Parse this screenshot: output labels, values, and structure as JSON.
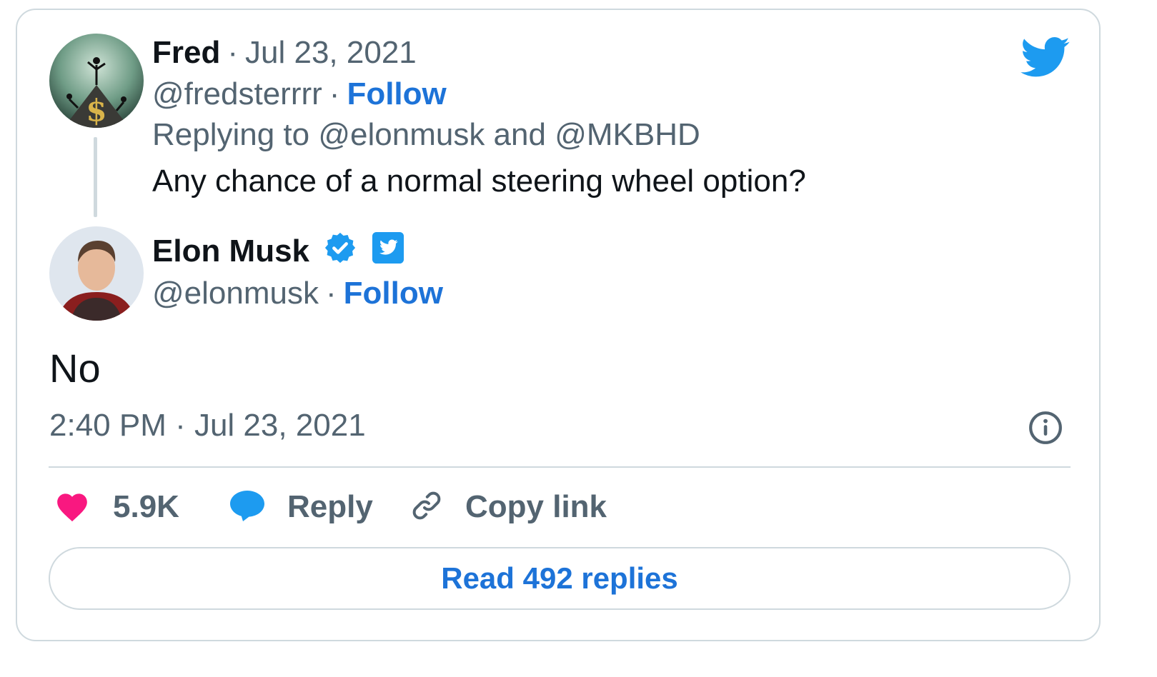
{
  "reply_tweet": {
    "author_name": "Fred",
    "date": "Jul 23, 2021",
    "handle": "@fredsterrrr",
    "follow_label": "Follow",
    "replying_to": "Replying to @elonmusk and @MKBHD",
    "text": "Any chance of a normal steering wheel option?"
  },
  "main_tweet": {
    "author_name": "Elon Musk",
    "handle": "@elonmusk",
    "follow_label": "Follow",
    "text": "No",
    "timestamp": "2:40 PM · Jul 23, 2021"
  },
  "separator": "·",
  "actions": {
    "likes": "5.9K",
    "reply_label": "Reply",
    "copy_link_label": "Copy link"
  },
  "read_replies_label": "Read 492 replies",
  "colors": {
    "accent": "#1d73d8",
    "twitter_blue": "#1d9bf0",
    "like_pink": "#f91880",
    "muted": "#536471",
    "border": "#cfd9de"
  }
}
